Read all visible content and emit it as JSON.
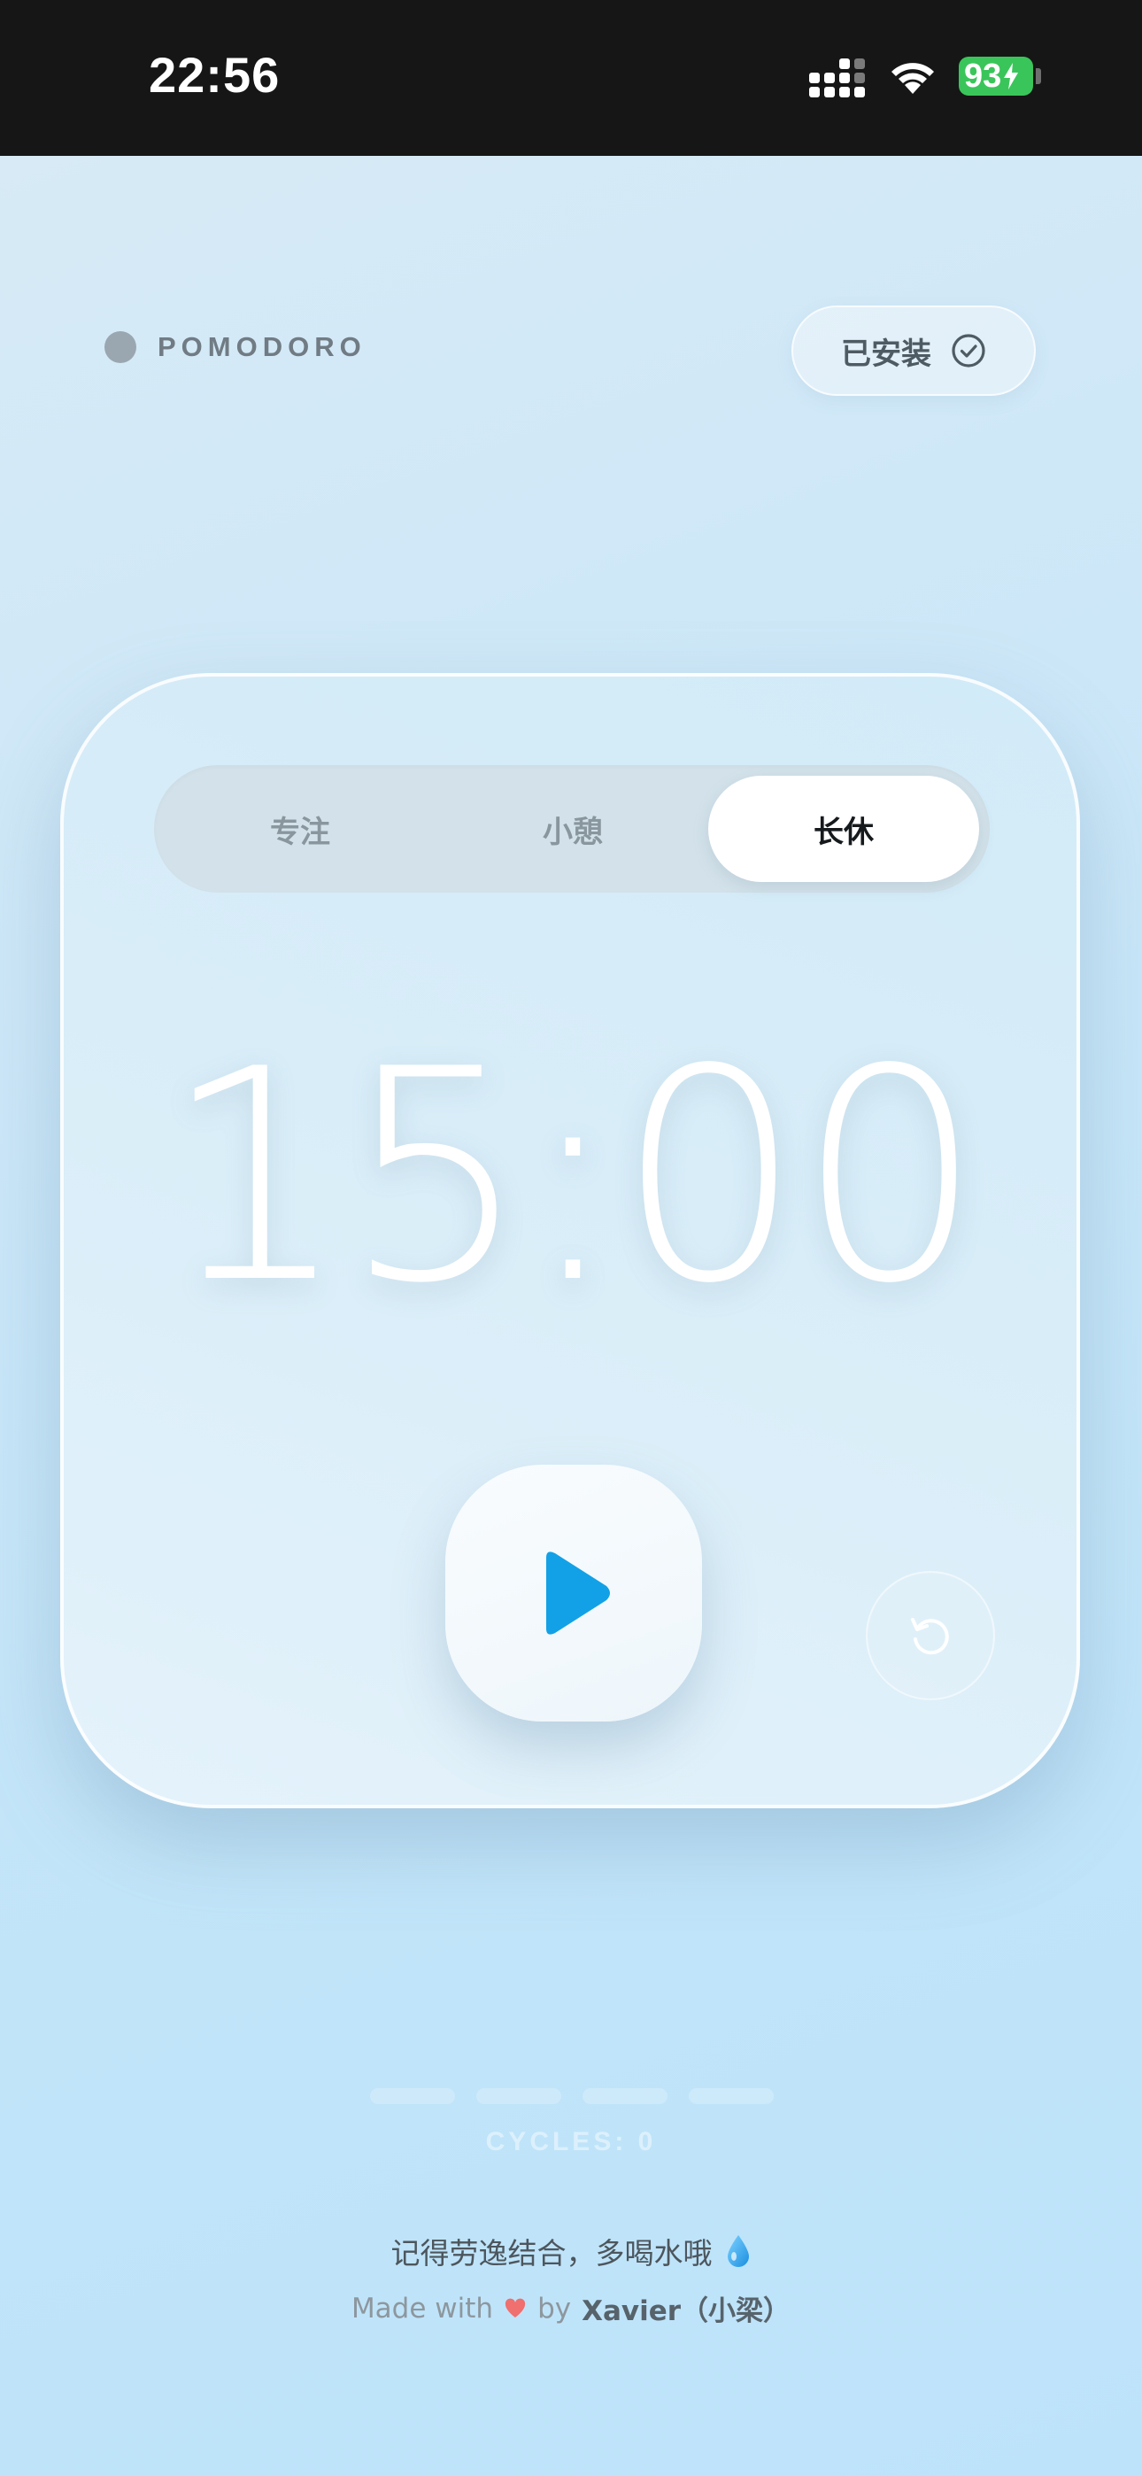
{
  "status_bar": {
    "time": "22:56",
    "battery": "93",
    "icons": [
      "signal-icon",
      "wifi-icon",
      "battery-icon",
      "charging-bolt-icon"
    ]
  },
  "header": {
    "brand": "POMODORO",
    "install_label": "已安装",
    "install_icon": "check-circle-icon"
  },
  "tabs": [
    {
      "label": "专注",
      "active": false
    },
    {
      "label": "小憩",
      "active": false
    },
    {
      "label": "长休",
      "active": true
    }
  ],
  "timer": {
    "display": "15:00"
  },
  "controls": {
    "play_icon": "play-icon",
    "reset_icon": "reset-icon"
  },
  "cycles": {
    "label": "CYCLES: 0",
    "total": 4,
    "completed": 0
  },
  "footer": {
    "tip": "记得劳逸结合，多喝水哦",
    "tip_icon": "water-drop-icon",
    "made_with": "Made with",
    "by": "by",
    "author": "Xavier（小梁）"
  },
  "colors": {
    "accent": "#12a1e6",
    "battery": "#3ac55a",
    "heart": "#f06f6f"
  }
}
